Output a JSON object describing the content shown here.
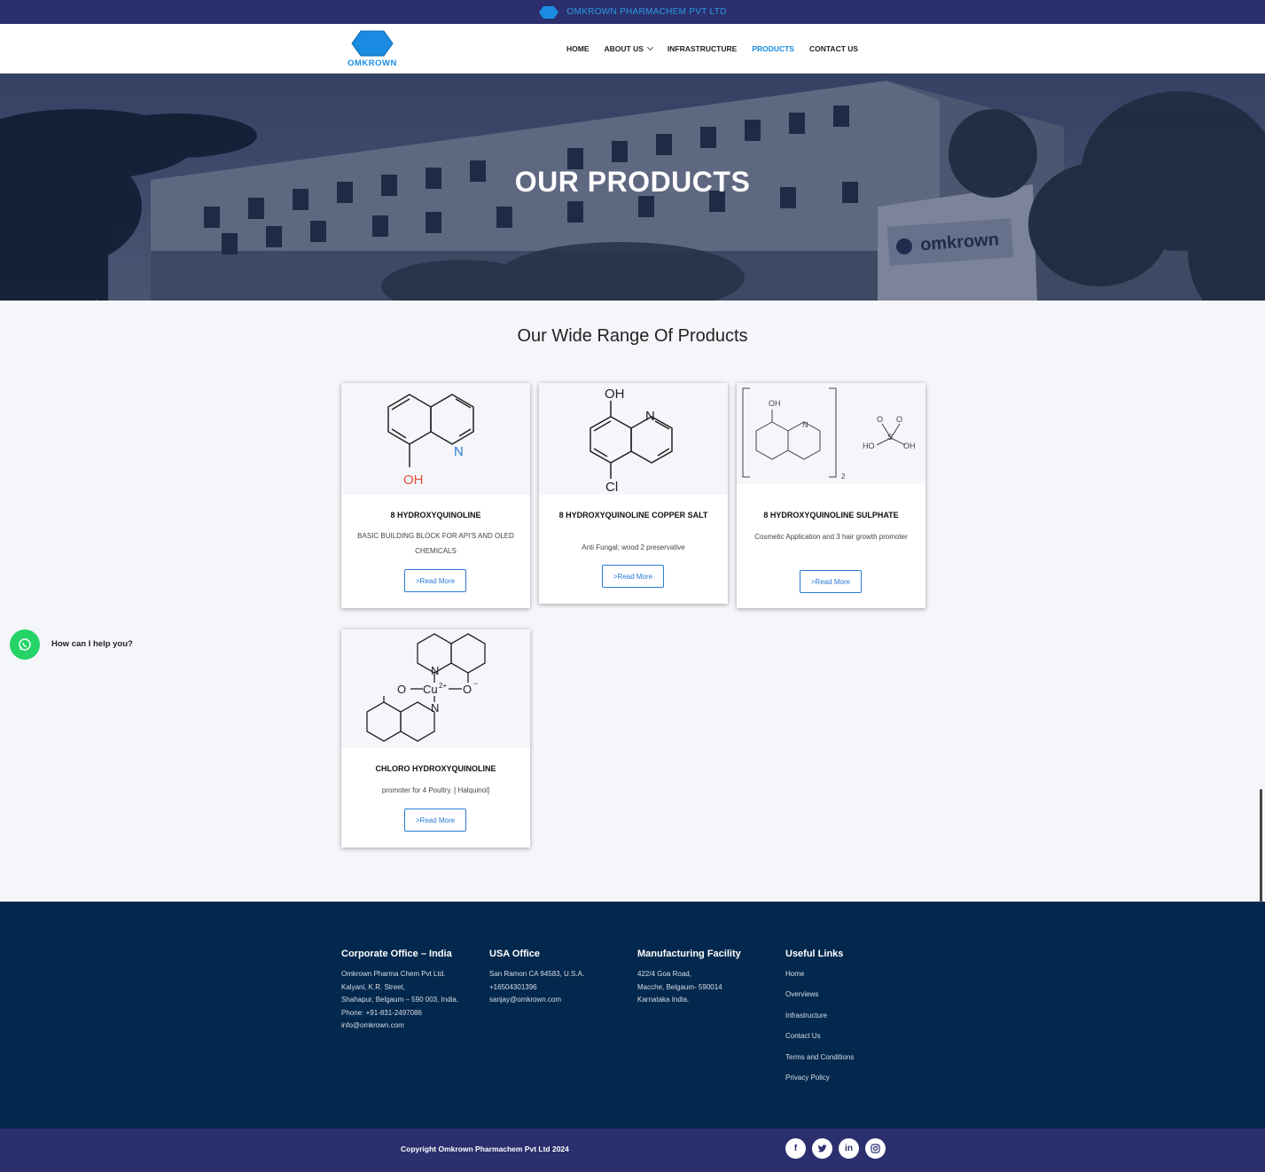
{
  "topbar": {
    "brand_text": "OMKROWN PHARMACHEM PVT LTD"
  },
  "logo": {
    "text": "OMKROWN"
  },
  "nav": {
    "items": [
      {
        "label": "HOME"
      },
      {
        "label": "ABOUT US"
      },
      {
        "label": "INFRASTRUCTURE"
      },
      {
        "label": "PRODUCTS"
      },
      {
        "label": "CONTACT US"
      }
    ],
    "active": "PRODUCTS"
  },
  "hero": {
    "title": "OUR PRODUCTS",
    "sign_text": "omkrown"
  },
  "section": {
    "title": "Our Wide Range Of Products"
  },
  "products": [
    {
      "title": "8 HYDROXYQUINOLINE",
      "description": "BASIC BUILDING BLOCK FOR API'S AND OLED CHEMICALS",
      "button": "Read More",
      "structure_labels": [
        "N",
        "OH"
      ]
    },
    {
      "title": "8 HYDROXYQUINOLINE COPPER SALT",
      "description": "Anti Fungal; wood 2 preservative",
      "button": "Read More",
      "structure_labels": [
        "OH",
        "N",
        "Cl"
      ]
    },
    {
      "title": "8 HYDROXYQUINOLINE SULPHATE",
      "description": "Cosmetic Application and 3 hair growth promoter",
      "button": "Read More",
      "structure_labels": [
        "OH",
        "N",
        "2",
        "O",
        "O",
        "S",
        "HO",
        "OH"
      ]
    },
    {
      "title": "CHLORO HYDROXYQUINOLINE",
      "description": "promoter for 4 Poultry. [ Halquinol]",
      "button": "Read More",
      "structure_labels": [
        "N",
        "O",
        "Cu",
        "2+",
        "O",
        "−",
        "N"
      ]
    }
  ],
  "whatsapp": {
    "text": "How can I help you?"
  },
  "footer": {
    "corporate": {
      "title": "Corporate Office – India",
      "lines": [
        "Omkrown Pharma Chem Pvt Ltd.",
        "Kalyani, K.R. Street,",
        "Shahapur, Belgaum – 590 003, India.",
        "Phone: +91-831-2497086",
        " info@omkrown.com"
      ]
    },
    "usa": {
      "title": "USA Office",
      "lines": [
        "San Ramon CA 94583, U.S.A.",
        "+16504301396",
        "sanjay@omkrown.com"
      ]
    },
    "manufacturing": {
      "title": "Manufacturing Facility",
      "lines": [
        "422/4 Goa Road,",
        "Macche, Belgaum- 590014",
        "Karnataka India."
      ]
    },
    "links": {
      "title": "Useful Links",
      "items": [
        "Home",
        "Overviews",
        "Infrastructure",
        "Contact Us",
        "Terms and Conditions",
        "Privacy Policy"
      ]
    }
  },
  "bottom": {
    "copyright": "Copyright Omkrown Pharmachem Pvt Ltd 2024",
    "socials": [
      "f",
      "t",
      "in",
      "ig"
    ]
  },
  "colors": {
    "topbar": "#2b2f6e",
    "accent": "#1a8be0",
    "footer": "#03284d",
    "whatsapp": "#25d366",
    "oh_red": "#e74c3c",
    "n_blue": "#2a7ad5"
  }
}
